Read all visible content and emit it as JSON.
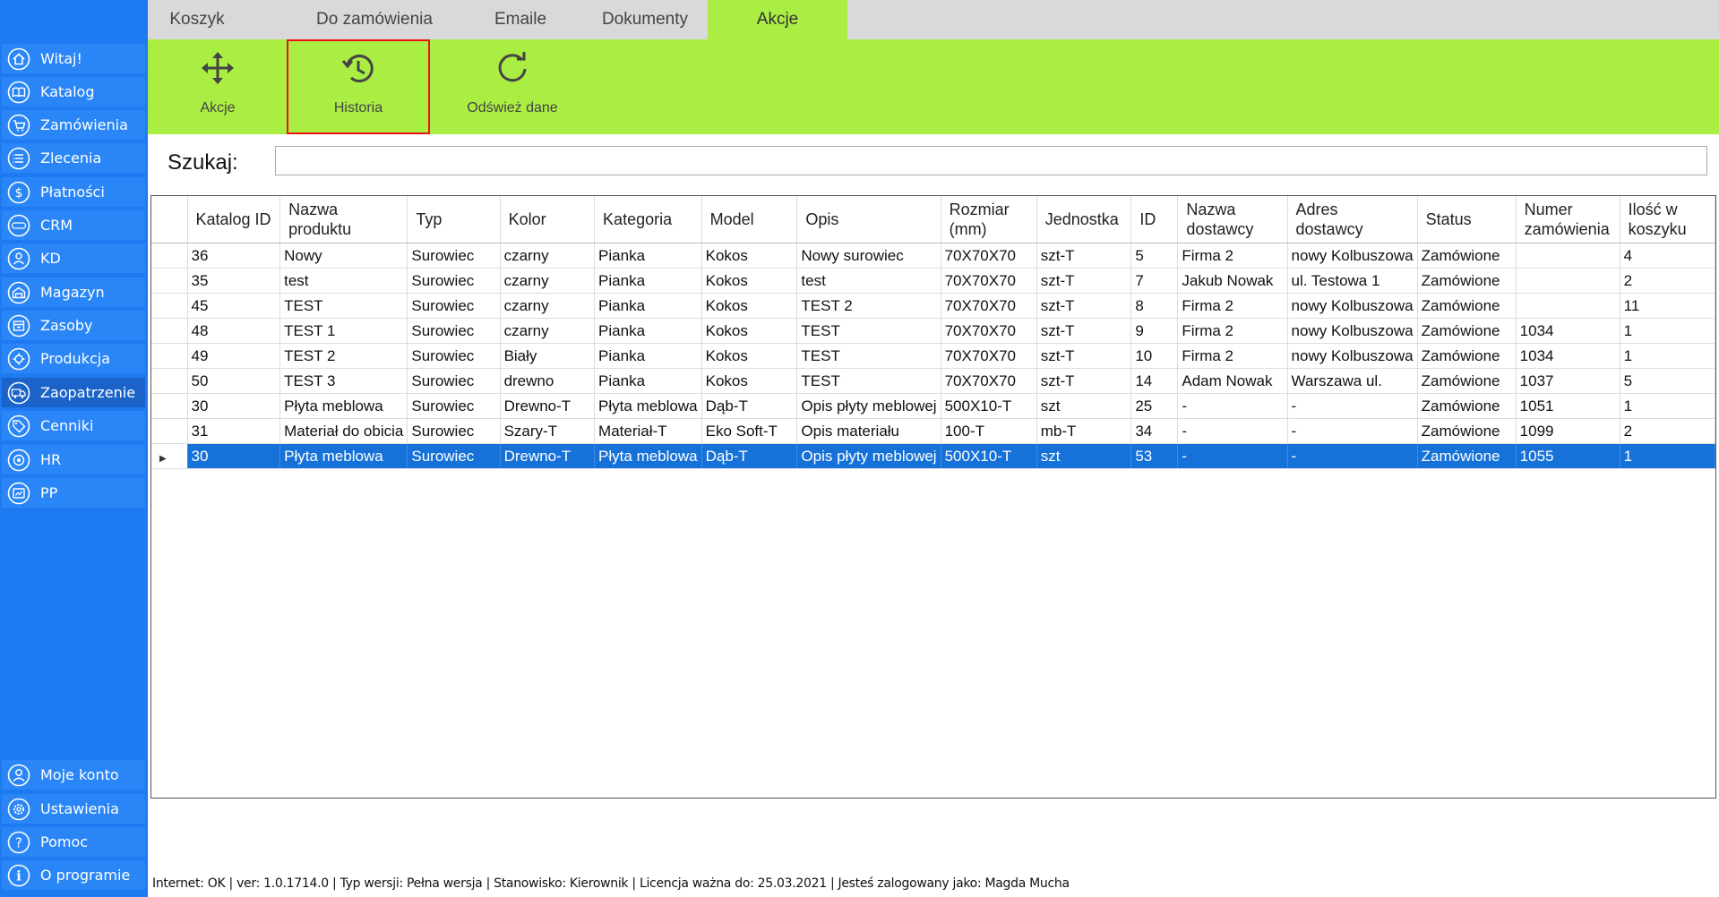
{
  "sidebar": {
    "items": [
      {
        "label": "Witaj!",
        "icon": "home-icon"
      },
      {
        "label": "Katalog",
        "icon": "book-icon"
      },
      {
        "label": "Zamówienia",
        "icon": "cart-icon"
      },
      {
        "label": "Zlecenia",
        "icon": "list-icon"
      },
      {
        "label": "Płatności",
        "icon": "dollar-icon"
      },
      {
        "label": "CRM",
        "icon": "crm-icon"
      },
      {
        "label": "KD",
        "icon": "user-icon"
      },
      {
        "label": "Magazyn",
        "icon": "warehouse-icon"
      },
      {
        "label": "Zasoby",
        "icon": "box-icon"
      },
      {
        "label": "Produkcja",
        "icon": "production-icon"
      },
      {
        "label": "Zaopatrzenie",
        "icon": "truck-icon"
      },
      {
        "label": "Cenniki",
        "icon": "tag-icon"
      },
      {
        "label": "HR",
        "icon": "hr-icon"
      },
      {
        "label": "PP",
        "icon": "pp-icon"
      }
    ],
    "bottom_items": [
      {
        "label": "Moje konto",
        "icon": "account-icon"
      },
      {
        "label": "Ustawienia",
        "icon": "settings-icon"
      },
      {
        "label": "Pomoc",
        "icon": "help-icon"
      },
      {
        "label": "O programie",
        "icon": "info-icon"
      }
    ]
  },
  "tabs": [
    "Koszyk",
    "Do zamówienia",
    "Emaile",
    "Dokumenty",
    "Akcje"
  ],
  "ribbon": {
    "buttons": [
      {
        "label": "Akcje",
        "icon": "move-arrows-icon"
      },
      {
        "label": "Historia",
        "icon": "history-clock-icon"
      },
      {
        "label": "Odśwież dane",
        "icon": "refresh-icon"
      }
    ]
  },
  "search": {
    "label": "Szukaj:",
    "value": ""
  },
  "grid": {
    "columns": [
      "Katalog ID",
      "Nazwa produktu",
      "Typ",
      "Kolor",
      "Kategoria",
      "Model",
      "Opis",
      "Rozmiar (mm)",
      "Jednostka",
      "ID",
      "Nazwa dostawcy",
      "Adres dostawcy",
      "Status",
      "Numer zamówienia",
      "Ilość w koszyku"
    ],
    "rows": [
      [
        "36",
        "Nowy",
        "Surowiec",
        "czarny",
        "Pianka",
        "Kokos",
        "Nowy surowiec",
        "70X70X70",
        "szt-T",
        "5",
        "Firma 2",
        "nowy Kolbuszowa",
        "Zamówione",
        "",
        "4"
      ],
      [
        "35",
        "test",
        "Surowiec",
        "czarny",
        "Pianka",
        "Kokos",
        "test",
        "70X70X70",
        "szt-T",
        "7",
        "Jakub Nowak",
        "ul. Testowa 1",
        "Zamówione",
        "",
        "2"
      ],
      [
        "45",
        "TEST",
        "Surowiec",
        "czarny",
        "Pianka",
        "Kokos",
        "TEST 2",
        "70X70X70",
        "szt-T",
        "8",
        "Firma 2",
        "nowy Kolbuszowa",
        "Zamówione",
        "",
        "11"
      ],
      [
        "48",
        "TEST 1",
        "Surowiec",
        "czarny",
        "Pianka",
        "Kokos",
        "TEST",
        "70X70X70",
        "szt-T",
        "9",
        "Firma 2",
        "nowy Kolbuszowa",
        "Zamówione",
        "1034",
        "1"
      ],
      [
        "49",
        "TEST 2",
        "Surowiec",
        "Biały",
        "Pianka",
        "Kokos",
        "TEST",
        "70X70X70",
        "szt-T",
        "10",
        "Firma 2",
        "nowy Kolbuszowa",
        "Zamówione",
        "1034",
        "1"
      ],
      [
        "50",
        "TEST 3",
        "Surowiec",
        "drewno",
        "Pianka",
        "Kokos",
        "TEST",
        "70X70X70",
        "szt-T",
        "14",
        "Adam Nowak",
        "Warszawa ul.",
        "Zamówione",
        "1037",
        "5"
      ],
      [
        "30",
        "Płyta meblowa",
        "Surowiec",
        "Drewno-T",
        "Płyta meblowa",
        "Dąb-T",
        "Opis płyty meblowej",
        "500X10-T",
        "szt",
        "25",
        "-",
        "-",
        "Zamówione",
        "1051",
        "1"
      ],
      [
        "31",
        "Materiał do obicia",
        "Surowiec",
        "Szary-T",
        "Materiał-T",
        "Eko Soft-T",
        "Opis materiału",
        "100-T",
        "mb-T",
        "34",
        "-",
        "-",
        "Zamówione",
        "1099",
        "2"
      ],
      [
        "30",
        "Płyta meblowa",
        "Surowiec",
        "Drewno-T",
        "Płyta meblowa",
        "Dąb-T",
        "Opis płyty meblowej",
        "500X10-T",
        "szt",
        "53",
        "-",
        "-",
        "Zamówione",
        "1055",
        "1"
      ]
    ],
    "selected_row": 8
  },
  "status_bar": "Internet: OK  |   ver: 1.0.1714.0   |   Typ wersji: Pełna wersja   |   Stanowisko: Kierownik   |   Licencja ważna do: 25.03.2021   |   Jesteś zalogowany jako: Magda Mucha",
  "colors": {
    "sidebar": "#1e7af0",
    "ribbon": "#aaee44",
    "selection": "#1672d8",
    "highlight": "#ee1111"
  }
}
